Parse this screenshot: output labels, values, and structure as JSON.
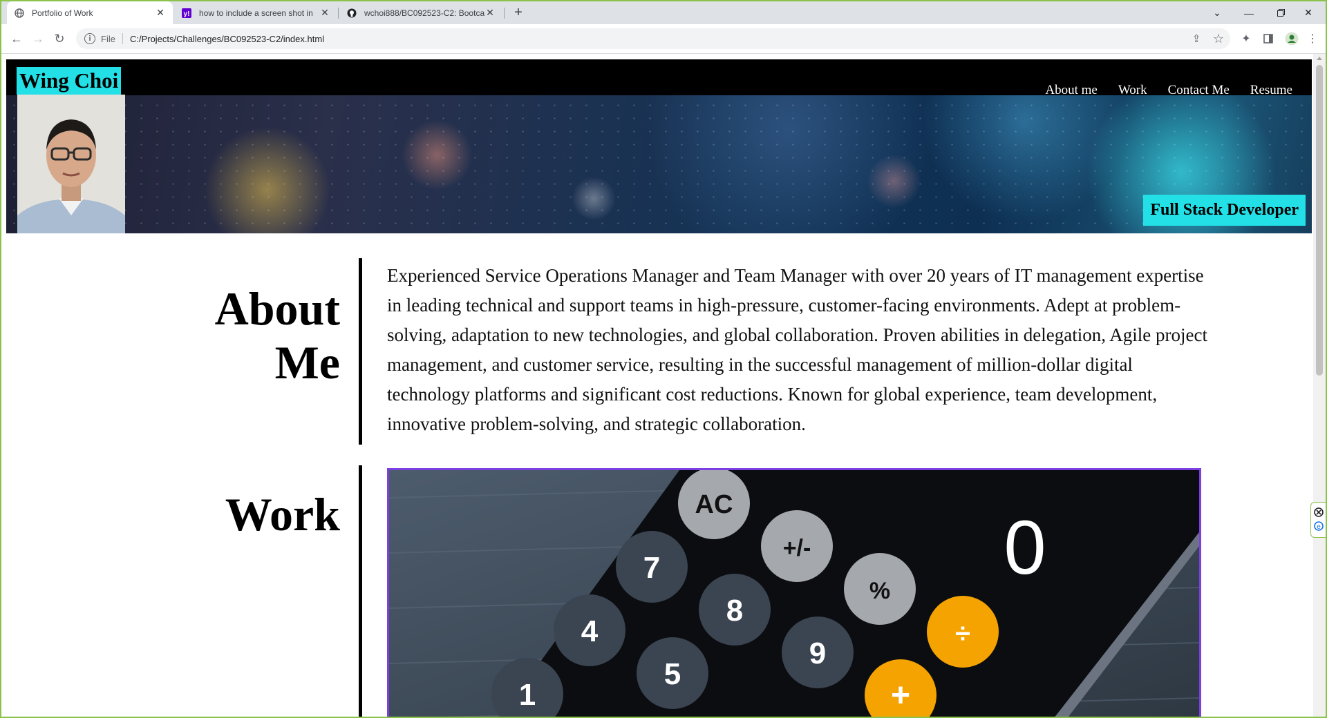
{
  "browser": {
    "tabs": [
      {
        "title": "Portfolio of Work",
        "favicon": "globe-icon",
        "active": true
      },
      {
        "title": "how to include a screen shot in",
        "favicon": "yahoo-icon",
        "active": false
      },
      {
        "title": "wchoi888/BC092523-C2: Bootca",
        "favicon": "github-icon",
        "active": false
      }
    ],
    "new_tab": "+",
    "address": {
      "scheme": "File",
      "url": "C:/Projects/Challenges/BC092523-C2/index.html"
    }
  },
  "header": {
    "brand": "Wing Choi",
    "nav": [
      "About me",
      "Work",
      "Contact Me",
      "Resume"
    ],
    "tagline": "Full Stack Developer"
  },
  "about": {
    "title_line1": "About",
    "title_line2": "Me",
    "text": "Experienced Service Operations Manager and Team Manager with over 20 years of IT management expertise in leading technical and support teams in high-pressure, customer-facing environments. Adept at problem-solving, adaptation to new technologies, and global collaboration. Proven abilities in delegation, Agile project management, and customer service, resulting in the successful management of million-dollar digital technology platforms and significant cost reductions. Known for global experience, team development, innovative problem-solving, and strategic collaboration."
  },
  "work": {
    "title": "Work",
    "keys": [
      "AC",
      "+/-",
      "%",
      "7",
      "8",
      "9",
      "4",
      "5",
      "1",
      "÷",
      "+",
      "0"
    ]
  },
  "colors": {
    "accent": "#22e0e6",
    "window_border": "#8bc34a",
    "work_border": "#7c3fe4"
  }
}
